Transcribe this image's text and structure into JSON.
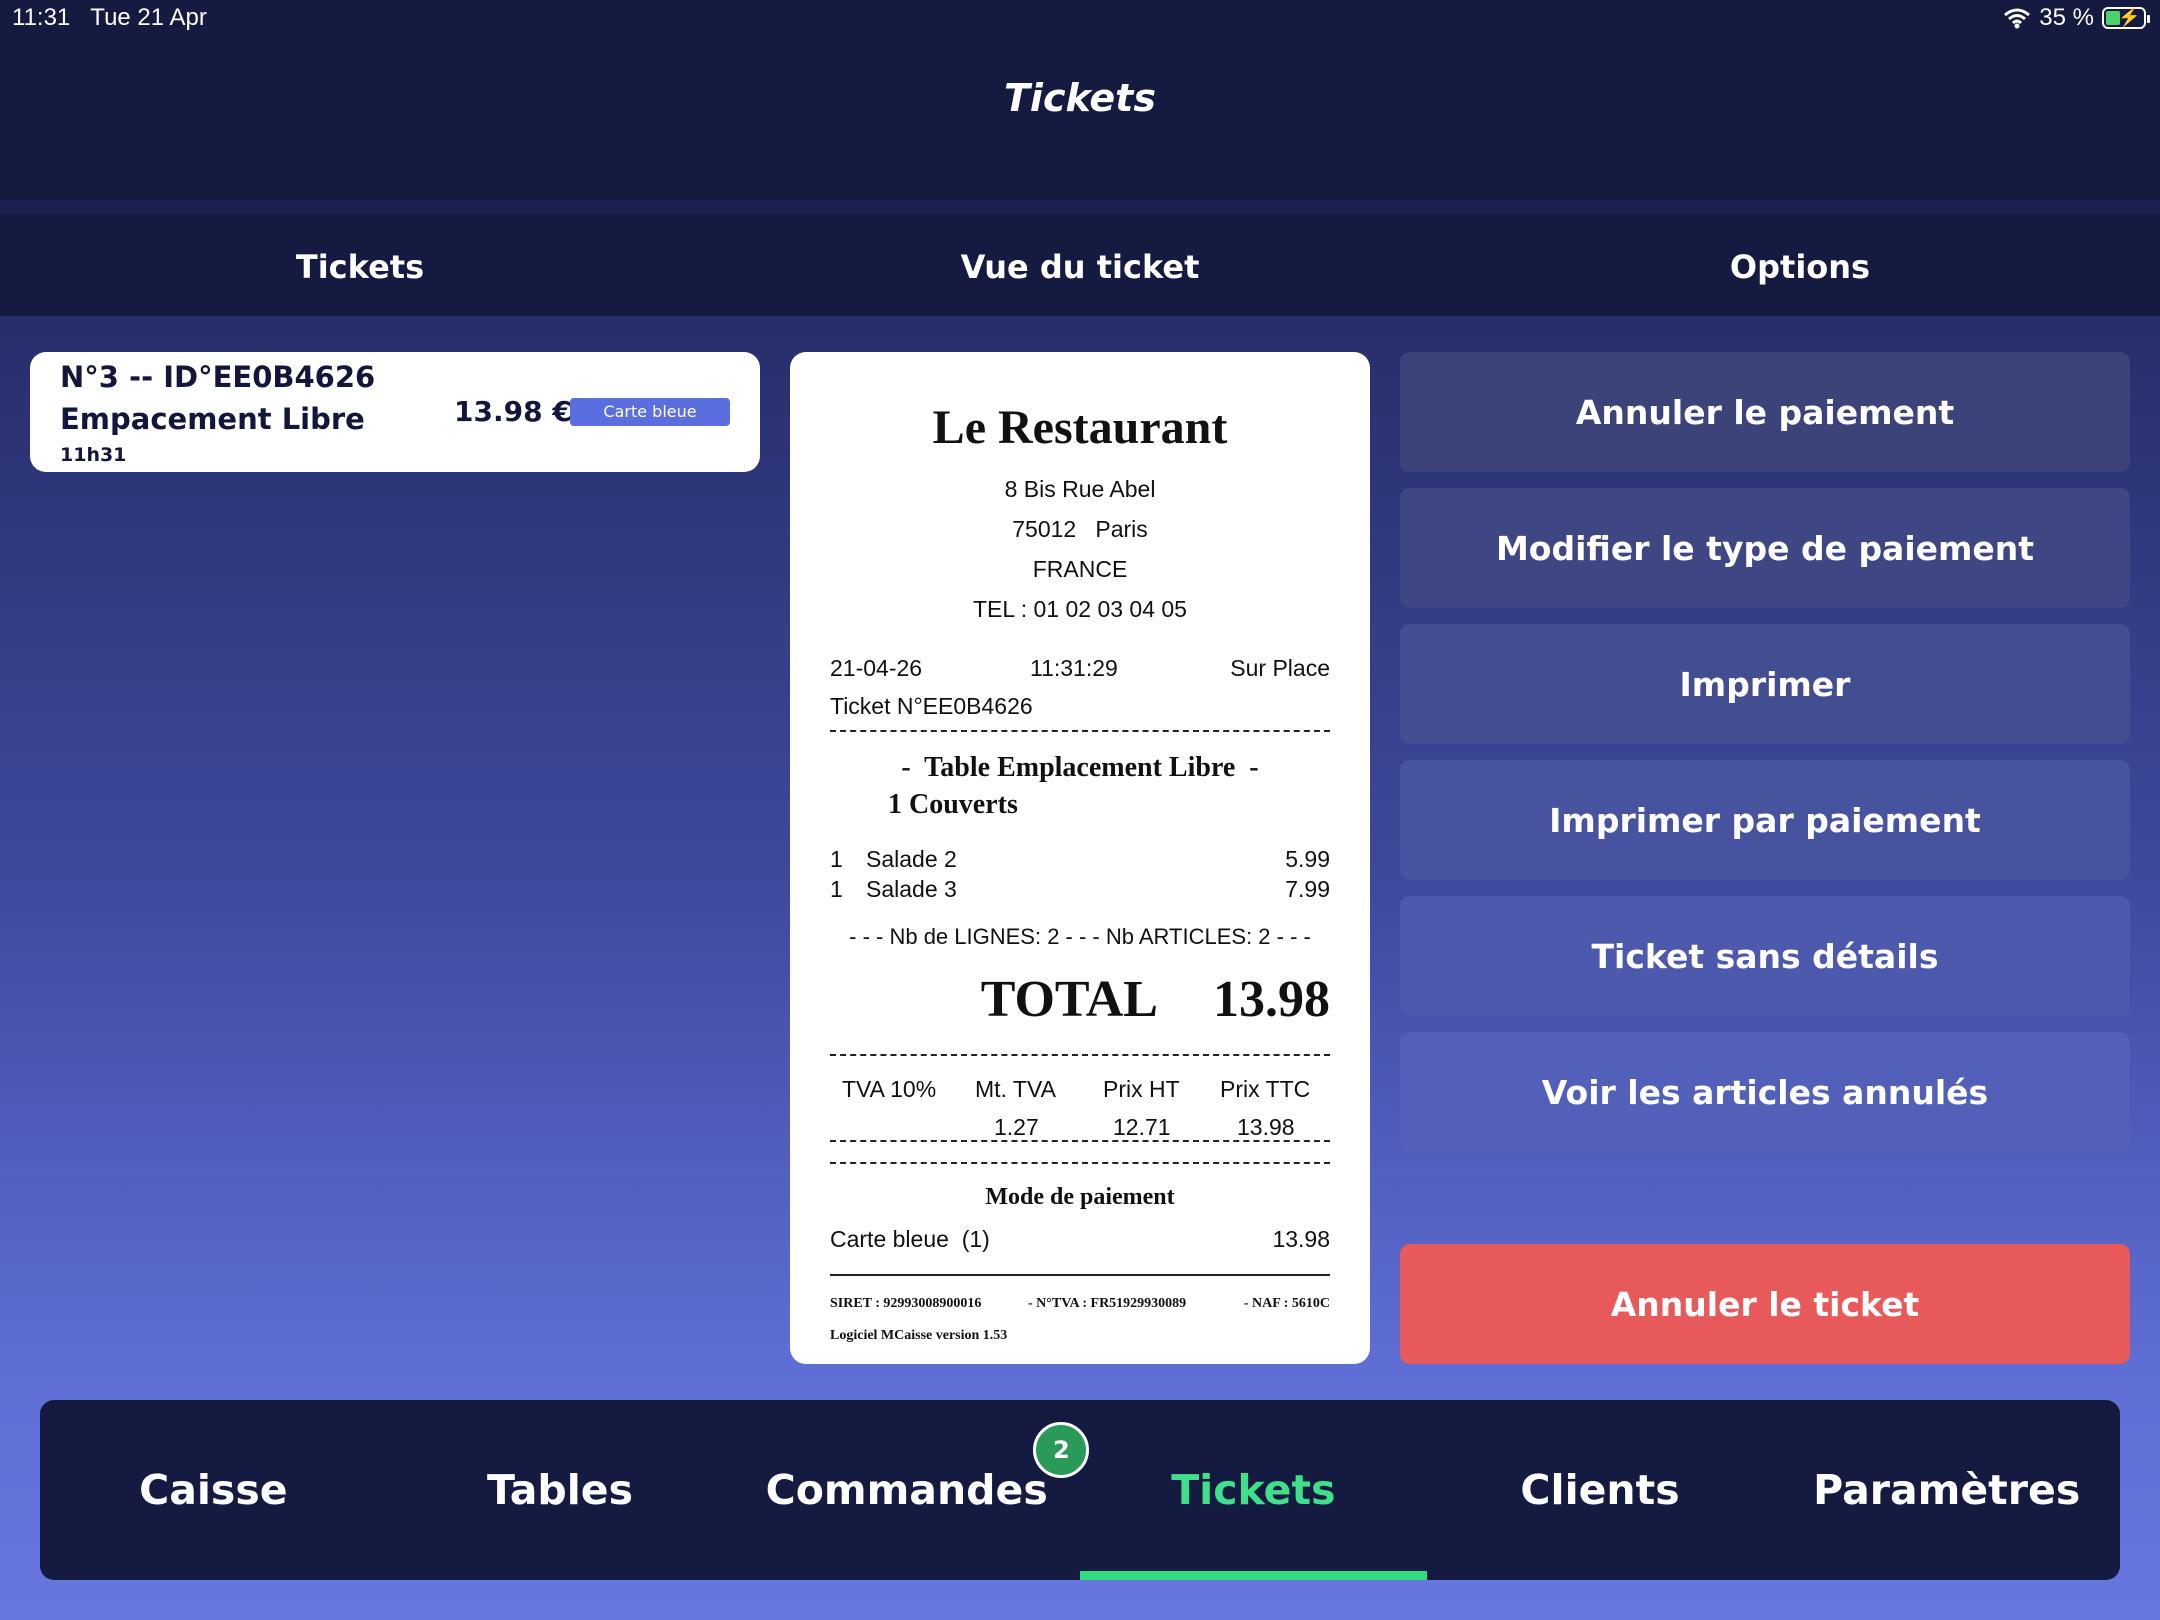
{
  "status": {
    "time": "11:31",
    "date": "Tue 21 Apr",
    "battery": "35 %"
  },
  "app_title": "Tickets",
  "columns": [
    "Tickets",
    "Vue du ticket",
    "Options"
  ],
  "ticket_list": [
    {
      "line1": "N°3 -- ID°EE0B4626",
      "line2": "Empacement Libre",
      "time": "11h31",
      "amount": "13.98 €",
      "payment_badge": "Carte bleue"
    }
  ],
  "receipt": {
    "name": "Le Restaurant",
    "address1": "8 Bis Rue Abel",
    "address2": "75012   Paris",
    "country": "FRANCE",
    "tel": "TEL : 01 02 03 04 05",
    "date": "21-04-26",
    "time": "11:31:29",
    "service": "Sur Place",
    "ticket_no": "Ticket N°EE0B4626",
    "table": "-  Table Emplacement Libre  -",
    "covers": "1 Couverts",
    "items": [
      {
        "qty": "1",
        "name": "Salade 2",
        "price": "5.99"
      },
      {
        "qty": "1",
        "name": "Salade 3",
        "price": "7.99"
      }
    ],
    "counts": "- - - Nb de LIGNES: 2 - - - Nb ARTICLES: 2 - - -",
    "total_label": "TOTAL",
    "total_value": "13.98",
    "tax_headers": [
      "TVA 10%",
      "Mt. TVA",
      "Prix HT",
      "Prix TTC"
    ],
    "tax_values": [
      "1.27",
      "12.71",
      "13.98"
    ],
    "payment_title": "Mode de paiement",
    "payment_line": "Carte bleue  (1)",
    "payment_amount": "13.98",
    "siret": "SIRET : 92993008900016",
    "tva_no": "- N°TVA : FR51929930089",
    "naf": "- NAF : 5610C",
    "software": "Logiciel MCaisse version 1.53"
  },
  "options": [
    {
      "label": "Annuler le paiement",
      "color": "#3c4378"
    },
    {
      "label": "Modifier le type de paiement",
      "color": "#3e4784"
    },
    {
      "label": "Imprimer",
      "color": "#434d92"
    },
    {
      "label": "Imprimer par paiement",
      "color": "#4853a0"
    },
    {
      "label": "Ticket sans détails",
      "color": "#4d59ad"
    },
    {
      "label": "Voir les articles annulés",
      "color": "#5360b9"
    }
  ],
  "cancel_ticket_label": "Annuler le ticket",
  "nav": {
    "items": [
      "Caisse",
      "Tables",
      "Commandes",
      "Tickets",
      "Clients",
      "Paramètres"
    ],
    "active": "Tickets",
    "commandes_badge": "2"
  },
  "colors": {
    "accent": "#2fdc7e",
    "danger": "#e85a5a",
    "badge": "#5a6ee0"
  }
}
